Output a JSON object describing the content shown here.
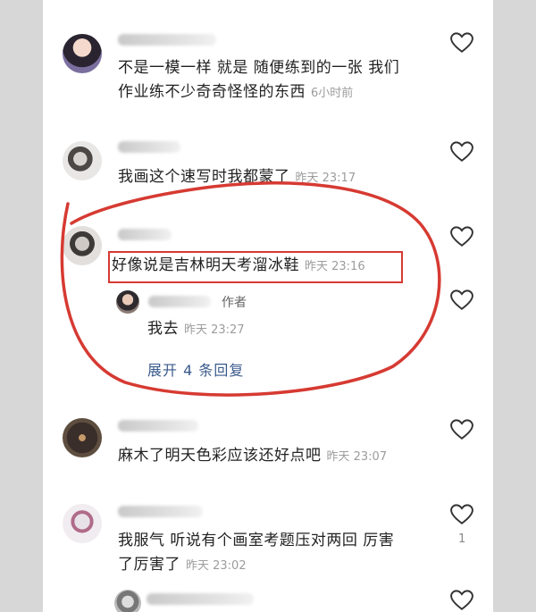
{
  "comments": [
    {
      "text_lines": [
        "不是一模一样 就是 随便练到的一张 我们",
        "作业练不少奇奇怪怪的东西"
      ],
      "time": "6小时前"
    },
    {
      "text_lines": [
        "我画这个速写时我都蒙了"
      ],
      "time": "昨天 23:17"
    },
    {
      "text_lines": [
        "好像说是吉林明天考溜冰鞋"
      ],
      "time": "昨天 23:16",
      "reply": {
        "author_tag": "作者",
        "text": "我去",
        "time": "昨天 23:27"
      },
      "expand_label": "展开 4 条回复"
    },
    {
      "text_lines": [
        "麻木了明天色彩应该还好点吧"
      ],
      "time": "昨天 23:07"
    },
    {
      "text_lines": [
        "我服气 听说有个画室考题压对两回 厉害",
        "了厉害了"
      ],
      "time": "昨天 23:02",
      "like_count": "1"
    }
  ],
  "colors": {
    "annotation_red": "#d63a32",
    "link_blue": "#3a5a8c",
    "time_gray": "#9c9c9c"
  },
  "icons": [
    "heart-icon"
  ]
}
